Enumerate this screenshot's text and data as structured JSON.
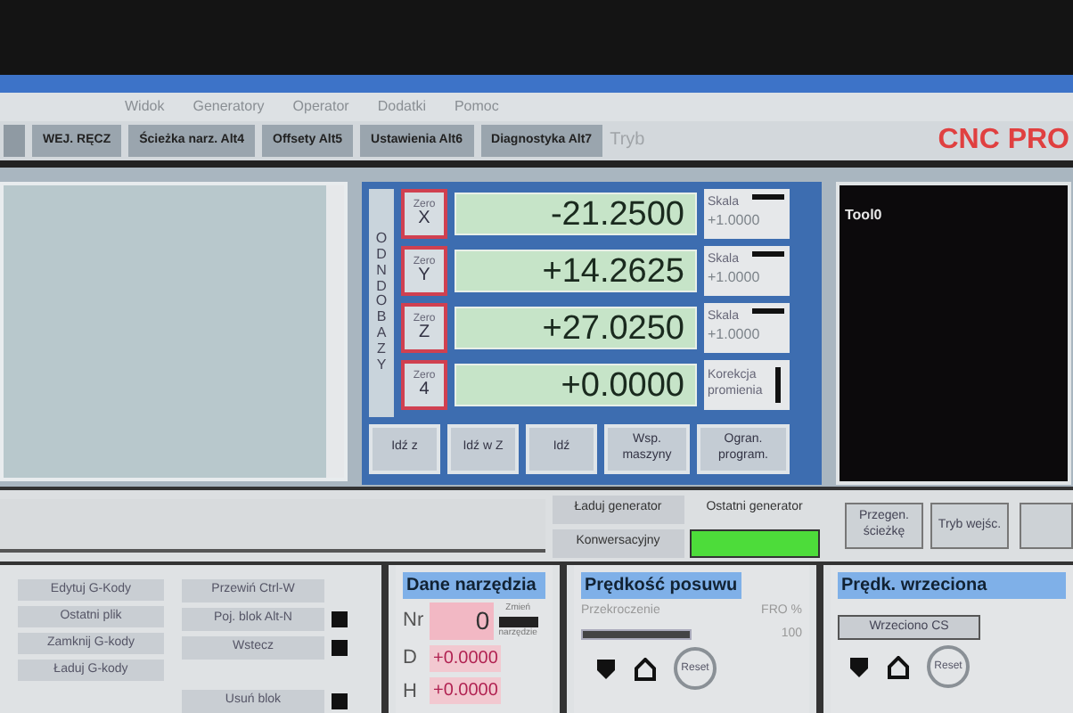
{
  "menu": [
    "Widok",
    "Generatory",
    "Operator",
    "Dodatki",
    "Pomoc"
  ],
  "tabs": [
    {
      "label": "WEJ. RĘCZ",
      "selected": false
    },
    {
      "label": "Ścieżka narz. Alt4",
      "selected": false
    },
    {
      "label": "Offsety Alt5",
      "selected": false
    },
    {
      "label": "Ustawienia Alt6",
      "selected": false
    },
    {
      "label": "Diagnostyka Alt7",
      "selected": false
    }
  ],
  "mode_label": "Tryb",
  "brand": "CNC PRO",
  "ref_all_home": "ODN DO BAZY",
  "axes": [
    {
      "kind": "scale",
      "zero": "Zero",
      "axis": "X",
      "value": "-21.2500",
      "side_label": "Skala",
      "side_value": "+1.0000"
    },
    {
      "kind": "scale",
      "zero": "Zero",
      "axis": "Y",
      "value": "+14.2625",
      "side_label": "Skala",
      "side_value": "+1.0000"
    },
    {
      "kind": "scale",
      "zero": "Zero",
      "axis": "Z",
      "value": "+27.0250",
      "side_label": "Skala",
      "side_value": "+1.0000"
    },
    {
      "kind": "radius",
      "zero": "Zero",
      "axis": "4",
      "value": "+0.0000",
      "side_label": "Korekcja promienia"
    }
  ],
  "dro_buttons": [
    "Idź z",
    "Idź w Z",
    "Idź",
    "Wsp. maszyny",
    "Ogran. program."
  ],
  "tool_display": "Tool0",
  "generator_buttons": [
    "Ładuj generator",
    "Ostatni generator",
    "Konwersacyjny"
  ],
  "right_buttons": [
    "Przegen. ścieżkę",
    "Tryb wejśc."
  ],
  "file_buttons": [
    "Edytuj G-Kody",
    "Ostatni plik",
    "Zamknij G-kody",
    "Ładuj G-kody"
  ],
  "run_buttons": [
    {
      "label": "Przewiń Ctrl-W",
      "led": false
    },
    {
      "label": "Poj. blok Alt-N",
      "led": true
    },
    {
      "label": "Wstecz",
      "led": true
    },
    {
      "label": "Usuń blok",
      "led": true
    }
  ],
  "tool_data": {
    "title": "Dane narzędzia",
    "nr_label": "Nr",
    "nr": "0",
    "change_label": "Zmień",
    "change_label_2": "narzędzie",
    "d_label": "D",
    "d": "+0.0000",
    "h_label": "H",
    "h": "+0.0000"
  },
  "feed": {
    "title": "Prędkość posuwu",
    "override_label": "Przekroczenie",
    "level": 1,
    "unit": "FRO %",
    "value": "100",
    "reset": "Reset"
  },
  "spindle": {
    "title": "Prędk. wrzeciona",
    "button": "Wrzeciono CS",
    "reset": "Reset"
  }
}
